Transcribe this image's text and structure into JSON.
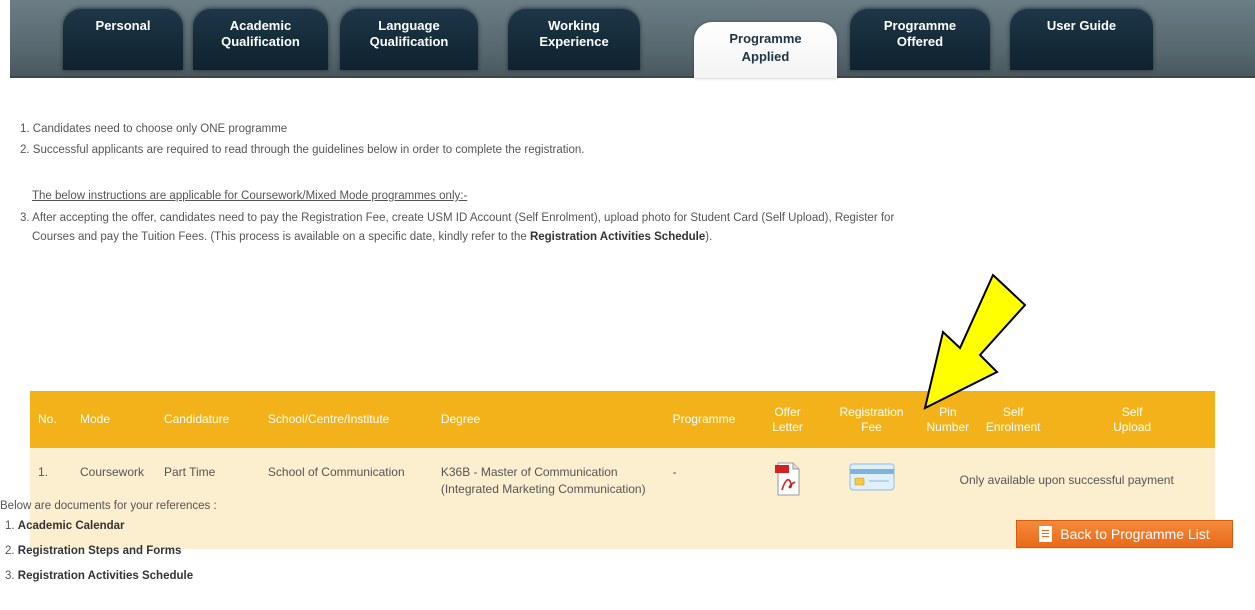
{
  "tabs": [
    {
      "line1": "Personal",
      "line2": ""
    },
    {
      "line1": "Academic",
      "line2": "Qualification"
    },
    {
      "line1": "Language",
      "line2": "Qualification"
    },
    {
      "line1": "Working",
      "line2": "Experience"
    },
    {
      "line1": "Programme",
      "line2": "Applied",
      "active": true
    },
    {
      "line1": "Programme",
      "line2": "Offered"
    },
    {
      "line1": "User Guide",
      "line2": ""
    }
  ],
  "instructions": {
    "item1": "1. Candidates need to choose only ONE programme",
    "item2": "2. Successful applicants are required to read through the guidelines below in order to complete the registration.",
    "subheading": "The below instructions are applicable for Coursework/Mixed Mode programmes only:-",
    "item3_line1": "3. After accepting the offer, candidates need to pay the Registration Fee, create USM ID Account (Self Enrolment), upload photo for Student Card (Self Upload), Register for",
    "item3_line2_a": "Courses and pay the Tuition Fees. (This process is available on a specific date, kindly refer to the ",
    "item3_line2_bold": "Registration Activities Schedule",
    "item3_line2_b": ")."
  },
  "table": {
    "headers": {
      "no": "No.",
      "mode": "Mode",
      "candidature": "Candidature",
      "school": "School/Centre/Institute",
      "degree": "Degree",
      "programme": "Programme",
      "offer_letter_1": "Offer",
      "offer_letter_2": "Letter",
      "reg_fee_1": "Registration",
      "reg_fee_2": "Fee",
      "pin_1": "Pin",
      "pin_2": "Number",
      "self_enrol_1": "Self",
      "self_enrol_2": "Enrolment",
      "self_upload_1": "Self",
      "self_upload_2": "Upload"
    },
    "row": {
      "no": "1.",
      "mode": "Coursework",
      "candidature": "Part Time",
      "school": "School of Communication",
      "degree": "K36B - Master of Communication (Integrated Marketing Communication)",
      "programme": "-",
      "note": "Only available upon successful payment"
    }
  },
  "references": {
    "heading": "Below are documents for your references :",
    "items": [
      {
        "num": "1.",
        "label": "Academic Calendar"
      },
      {
        "num": "2.",
        "label": "Registration Steps and Forms"
      },
      {
        "num": "3.",
        "label": "Registration Activities Schedule"
      }
    ]
  },
  "back_button": "Back to Programme List",
  "colors": {
    "tab_bg": "#142a38",
    "table_header": "#f4b21a",
    "table_row": "#fbefcf",
    "back_button": "#e86a1a",
    "arrow": "#ffff00"
  },
  "icons": {
    "offer_letter": "pdf-icon",
    "registration_fee": "credit-card-icon",
    "back_button": "document-icon",
    "annotation": "arrow-pointer"
  }
}
